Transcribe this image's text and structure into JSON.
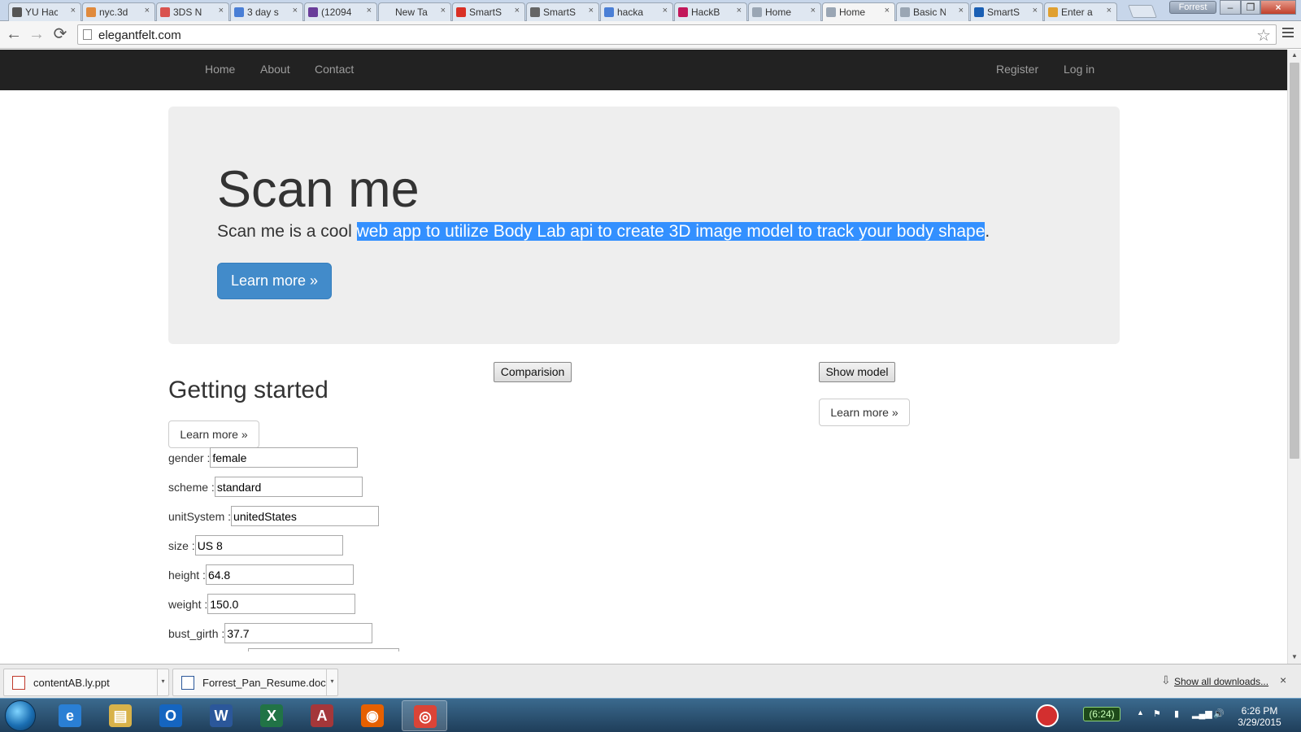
{
  "browser": {
    "tabs": [
      {
        "label": "YU Hac",
        "color": "#555555"
      },
      {
        "label": "nyc.3d",
        "color": "#e08a3c"
      },
      {
        "label": "3DS N",
        "color": "#d9534f"
      },
      {
        "label": "3 day s",
        "color": "#4a7fd6"
      },
      {
        "label": "(12094",
        "color": "#6a3d9a"
      },
      {
        "label": "New Tab",
        "color": ""
      },
      {
        "label": "SmartS",
        "color": "#d93025"
      },
      {
        "label": "SmartS",
        "color": "#666666"
      },
      {
        "label": "hacka",
        "color": "#4a7fd6"
      },
      {
        "label": "HackB",
        "color": "#c2185b"
      },
      {
        "label": "Home",
        "color": "#9aa6b4"
      },
      {
        "label": "Home",
        "color": "#9aa6b4"
      },
      {
        "label": "Basic N",
        "color": "#9aa6b4"
      },
      {
        "label": "SmartS",
        "color": "#1a5fb4"
      },
      {
        "label": "Enter a",
        "color": "#e0a030"
      }
    ],
    "active_tab_index": 11,
    "profile_name": "Forrest",
    "url": "elegantfelt.com",
    "back_icon": "←",
    "forward_icon": "→",
    "reload_icon": "⟳",
    "star_icon": "☆",
    "tab_close": "×",
    "win_min": "–",
    "win_max": "❐",
    "win_close": "×"
  },
  "site": {
    "nav_left": [
      "Home",
      "About",
      "Contact"
    ],
    "nav_right": [
      "Register",
      "Log in"
    ],
    "hero": {
      "title": "Scan me",
      "text_plain": "Scan me is a cool ",
      "text_selected": "web app to utilize Body Lab api to create 3D image model to track your body shape",
      "text_end": ".",
      "button": "Learn more »"
    },
    "comparison_button": "Comparision",
    "show_model_button": "Show model",
    "learn_more_right": "Learn more »",
    "getting_started": {
      "heading": "Getting started",
      "button": "Learn more »"
    },
    "fields": [
      {
        "label": "gender :",
        "value": "female"
      },
      {
        "label": "scheme :",
        "value": "standard"
      },
      {
        "label": "unitSystem :",
        "value": "unitedStates"
      },
      {
        "label": "size :",
        "value": "US 8"
      },
      {
        "label": "height :",
        "value": "64.8"
      },
      {
        "label": "weight :",
        "value": "150.0"
      },
      {
        "label": "bust_girth :",
        "value": "37.7"
      }
    ]
  },
  "downloads": {
    "items": [
      "contentAB.ly.ppt",
      "Forrest_Pan_Resume.doc"
    ],
    "show_all": "Show all downloads...",
    "close": "×",
    "dropdown_icon": "▾",
    "download_icon": "⇩"
  },
  "taskbar": {
    "apps": [
      {
        "name": "internet-explorer",
        "glyph": "e",
        "color": "#2a7fd4"
      },
      {
        "name": "file-explorer",
        "glyph": "▤",
        "color": "#d8b24a"
      },
      {
        "name": "outlook",
        "glyph": "O",
        "color": "#1565c0"
      },
      {
        "name": "word",
        "glyph": "W",
        "color": "#2b579a"
      },
      {
        "name": "excel",
        "glyph": "X",
        "color": "#217346"
      },
      {
        "name": "access",
        "glyph": "A",
        "color": "#a4373a"
      },
      {
        "name": "firefox",
        "glyph": "◉",
        "color": "#e66000"
      },
      {
        "name": "chrome",
        "glyph": "◎",
        "color": "#db4437"
      }
    ],
    "battery": "(6:24)",
    "time": "6:26 PM",
    "date": "3/29/2015",
    "tray_up": "▲",
    "tray_icons": [
      "⚑",
      "▮",
      "▂▄▆",
      "🔊"
    ]
  }
}
